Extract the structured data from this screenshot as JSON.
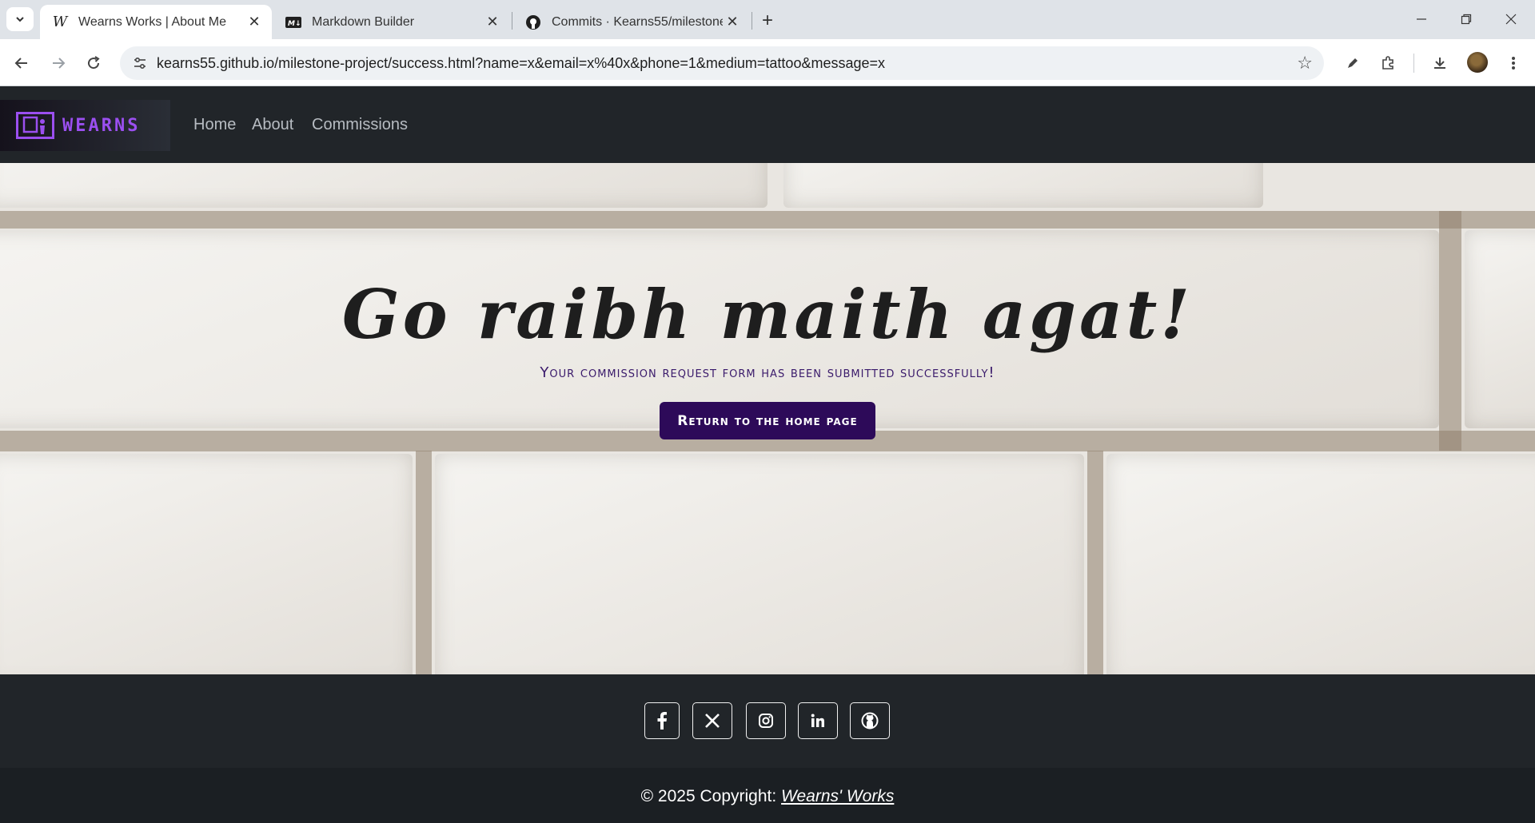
{
  "browser": {
    "tabs": [
      {
        "title": "Wearns Works | About Me",
        "favicon": "W",
        "active": true
      },
      {
        "title": "Markdown Builder",
        "favicon": "M↓",
        "active": false
      },
      {
        "title": "Commits · Kearns55/milestone-",
        "favicon": "github-icon",
        "active": false
      }
    ],
    "url": "kearns55.github.io/milestone-project/success.html?name=x&email=x%40x&phone=1&medium=tattoo&message=x"
  },
  "site": {
    "brand": "WEARNS",
    "nav": [
      "Home",
      "About",
      "Commissions"
    ],
    "hero": {
      "title": "Go raibh maith agat!",
      "subtitle": "Your commission request form has been submitted successfully!",
      "button": "Return to the home page"
    },
    "footer": {
      "social": [
        "facebook-icon",
        "x-icon",
        "instagram-icon",
        "linkedin-icon",
        "github-icon"
      ],
      "copyright_prefix": "© 2025 Copyright:",
      "copyright_link": "Wearns' Works"
    }
  },
  "colors": {
    "nav_bg": "#212529",
    "brand_accent": "#9b4ff0",
    "button_bg": "#2d0a59",
    "subtitle": "#3a1a6b"
  }
}
